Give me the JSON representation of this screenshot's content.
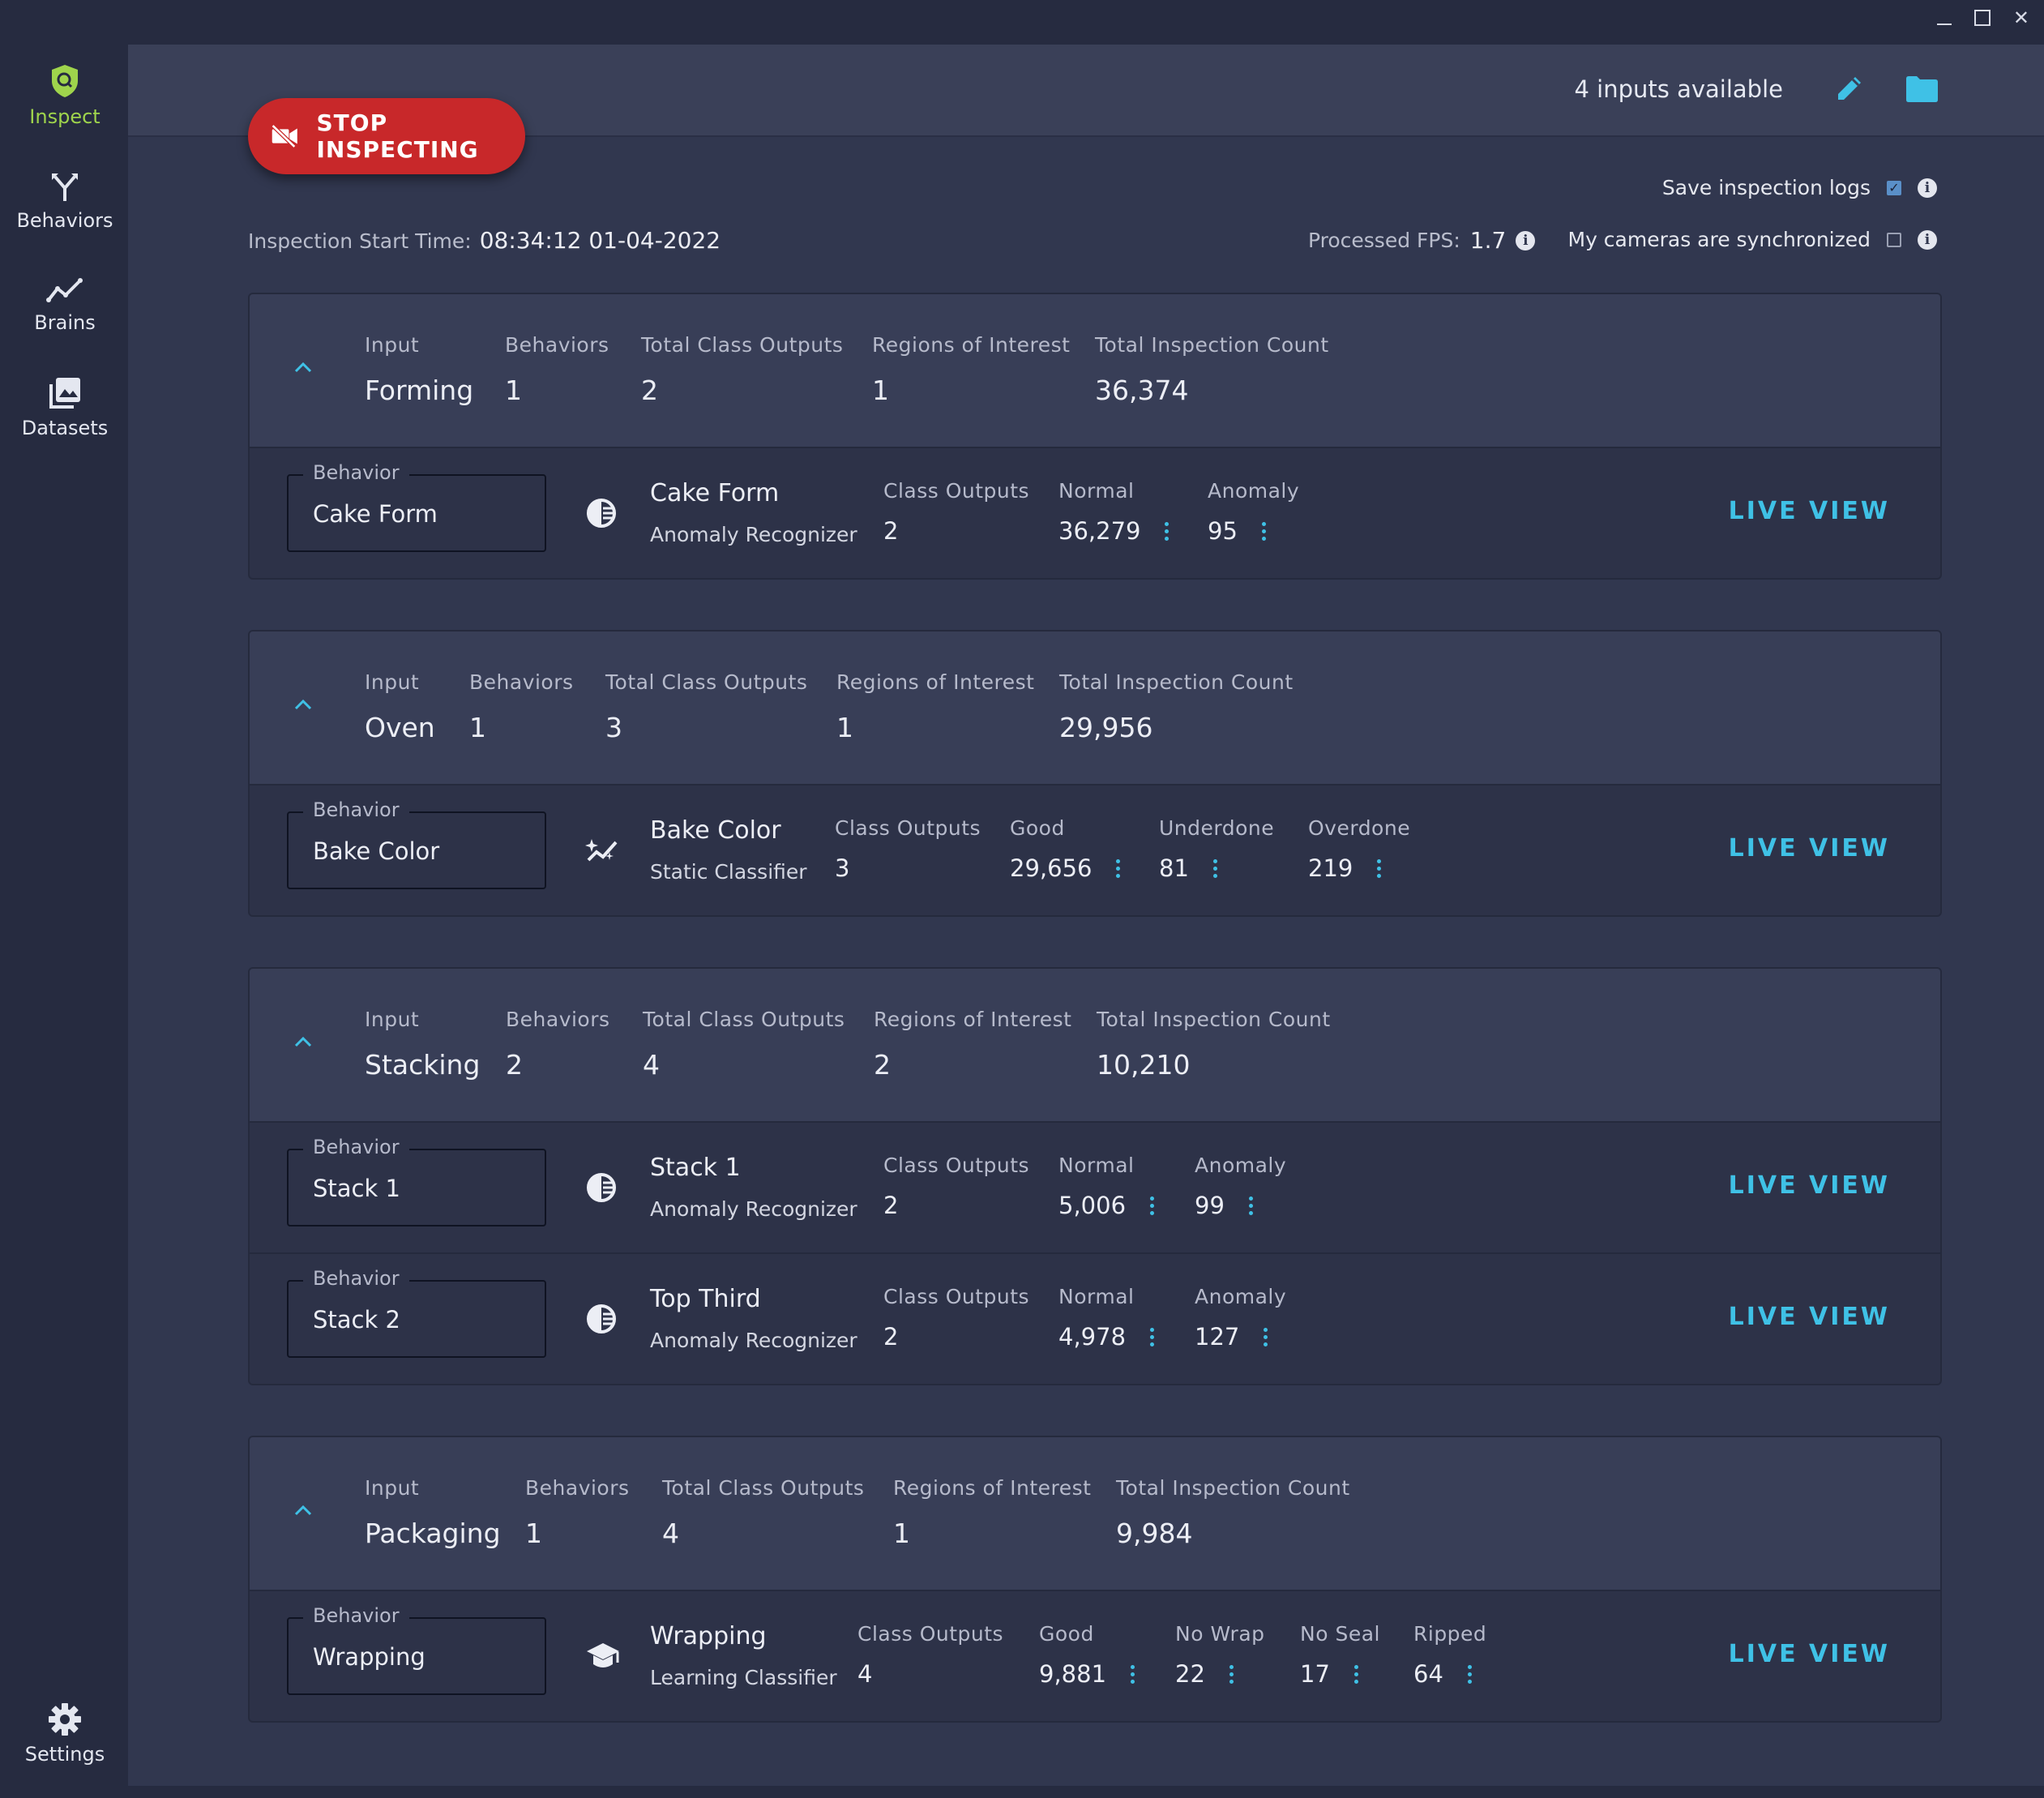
{
  "window": {
    "minimize": "minimize",
    "maximize": "maximize",
    "close": "close"
  },
  "sidebar": {
    "items": [
      {
        "label": "Inspect",
        "icon": "inspect-shield-icon",
        "active": true
      },
      {
        "label": "Behaviors",
        "icon": "behaviors-fork-icon"
      },
      {
        "label": "Brains",
        "icon": "brains-trend-icon"
      },
      {
        "label": "Datasets",
        "icon": "datasets-images-icon"
      }
    ],
    "settings": {
      "label": "Settings",
      "icon": "gear-icon"
    }
  },
  "header": {
    "inputs_available": "4 inputs available",
    "edit_icon": "pencil-icon",
    "folder_icon": "folder-icon"
  },
  "stop_button": {
    "label": "STOP INSPECTING",
    "icon": "video-off-icon"
  },
  "inspection": {
    "start_label": "Inspection Start Time:",
    "start_value": "08:34:12 01-04-2022",
    "fps_label": "Processed FPS:",
    "fps_value": "1.7",
    "save_logs_label": "Save inspection logs",
    "save_logs_checked": true,
    "sync_label": "My cameras are synchronized",
    "sync_checked": false
  },
  "labels": {
    "input": "Input",
    "behaviors": "Behaviors",
    "total_class_outputs": "Total Class Outputs",
    "regions": "Regions of Interest",
    "total_count": "Total Inspection Count",
    "behavior": "Behavior",
    "class_outputs": "Class Outputs",
    "live_view": "LIVE VIEW"
  },
  "colors": {
    "accent": "#3fc1e6",
    "active_nav": "#9fd44c",
    "stop": "#c8282a"
  },
  "inputs": [
    {
      "name": "Forming",
      "behaviors": "1",
      "total_class_outputs": "2",
      "regions": "1",
      "total_count": "36,374",
      "behavior_rows": [
        {
          "behavior": "Cake Form",
          "name": "Cake Form",
          "type": "Anomaly Recognizer",
          "icon": "anomaly-recognizer-icon",
          "class_outputs": "2",
          "classes": [
            {
              "label": "Normal",
              "value": "36,279"
            },
            {
              "label": "Anomaly",
              "value": "95"
            }
          ]
        }
      ]
    },
    {
      "name": "Oven",
      "behaviors": "1",
      "total_class_outputs": "3",
      "regions": "1",
      "total_count": "29,956",
      "behavior_rows": [
        {
          "behavior": "Bake Color",
          "name": "Bake Color",
          "type": "Static Classifier",
          "icon": "static-classifier-icon",
          "class_outputs": "3",
          "classes": [
            {
              "label": "Good",
              "value": "29,656"
            },
            {
              "label": "Underdone",
              "value": "81"
            },
            {
              "label": "Overdone",
              "value": "219"
            }
          ]
        }
      ]
    },
    {
      "name": "Stacking",
      "behaviors": "2",
      "total_class_outputs": "4",
      "regions": "2",
      "total_count": "10,210",
      "behavior_rows": [
        {
          "behavior": "Stack 1",
          "name": "Stack 1",
          "type": "Anomaly Recognizer",
          "icon": "anomaly-recognizer-icon",
          "class_outputs": "2",
          "classes": [
            {
              "label": "Normal",
              "value": "5,006"
            },
            {
              "label": "Anomaly",
              "value": "99"
            }
          ]
        },
        {
          "behavior": "Stack 2",
          "name": "Top Third",
          "type": "Anomaly Recognizer",
          "icon": "anomaly-recognizer-icon",
          "class_outputs": "2",
          "classes": [
            {
              "label": "Normal",
              "value": "4,978"
            },
            {
              "label": "Anomaly",
              "value": "127"
            }
          ]
        }
      ]
    },
    {
      "name": "Packaging",
      "behaviors": "1",
      "total_class_outputs": "4",
      "regions": "1",
      "total_count": "9,984",
      "behavior_rows": [
        {
          "behavior": "Wrapping",
          "name": "Wrapping",
          "type": "Learning Classifier",
          "icon": "learning-classifier-icon",
          "class_outputs": "4",
          "classes": [
            {
              "label": "Good",
              "value": "9,881"
            },
            {
              "label": "No Wrap",
              "value": "22"
            },
            {
              "label": "No Seal",
              "value": "17"
            },
            {
              "label": "Ripped",
              "value": "64"
            }
          ]
        }
      ]
    }
  ]
}
